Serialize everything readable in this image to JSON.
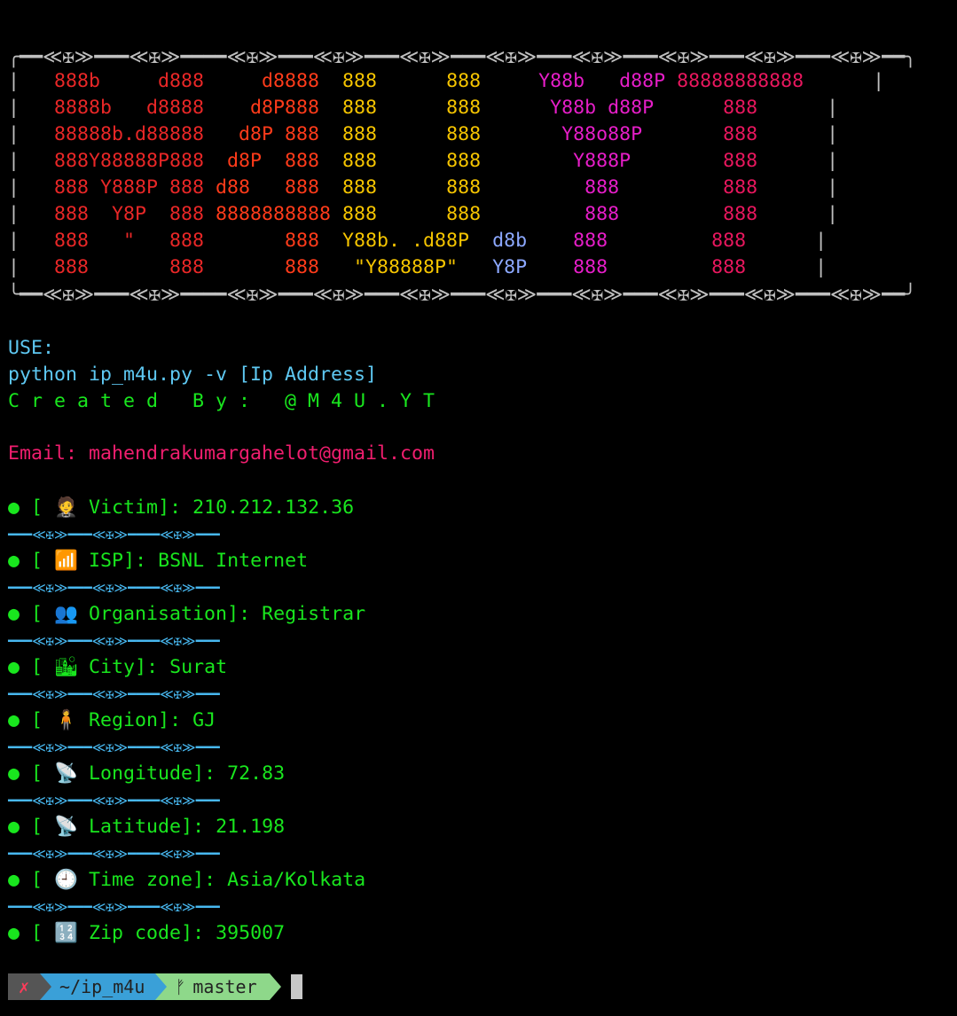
{
  "banner": {
    "top_border": "╭━━≪✠≫━━━≪✠≫━━━━≪✠≫━━━≪✠≫━━━≪✠≫━━━≪✠≫━━━≪✠≫━━━≪✠≫━━━≪✠≫━━━≪✠≫━━╮",
    "bottom_border": "╰━━≪✠≫━━━≪✠≫━━━━≪✠≫━━━≪✠≫━━━≪✠≫━━━≪✠≫━━━≪✠≫━━━≪✠≫━━━≪✠≫━━━≪✠≫━━╯",
    "lines": [
      [
        "|   ",
        "888b     d888",
        "     d8888",
        "  888",
        "      888",
        "     Y88b   d88P",
        " 88888888888",
        "      |"
      ],
      [
        "|   ",
        "8888b   d8888",
        "    d8P888",
        "  888",
        "      888",
        "      Y88b d88P",
        "      888",
        "      |"
      ],
      [
        "|   ",
        "88888b.d88888",
        "   d8P 888",
        "  888",
        "      888",
        "       Y88o88P",
        "       888",
        "      |"
      ],
      [
        "|   ",
        "888Y88888P888",
        "  d8P  888",
        "  888",
        "      888",
        "        Y888P",
        "        888",
        "      |"
      ],
      [
        "|   ",
        "888 Y888P 888",
        " d88   888",
        "  888",
        "      888",
        "         888",
        "         888",
        "      |"
      ],
      [
        "|   ",
        "888  Y8P  888",
        " 8888888888",
        " 888",
        "      888",
        "         888",
        "         888",
        "      |"
      ],
      [
        "|   ",
        "888   \"   888",
        "       888",
        "  Y88b. .d88P",
        "  d8b",
        "    888",
        "         888",
        "      |"
      ],
      [
        "|   ",
        "888       888",
        "       888",
        "   \"Y88888P\"",
        "   Y8P",
        "    888",
        "         888",
        "      |"
      ]
    ]
  },
  "use_label": "USE:",
  "usage": "python ip_m4u.py -v [Ip Address]",
  "created_by": "C r e a t e d   B y :   @ M 4 U . Y T",
  "email": "Email: mahendrakumargahelot@gmail.com",
  "separator": "━━━≪✠≫━━━≪✠≫━━━━≪✠≫━━━",
  "info": [
    {
      "icon": "🤵",
      "label": "Victim",
      "value": "210.212.132.36"
    },
    {
      "icon": "📶",
      "label": "ISP",
      "value": "BSNL Internet"
    },
    {
      "icon": "👥",
      "label": "Organisation",
      "value": "Registrar"
    },
    {
      "icon": "🏙",
      "label": "City",
      "value": "Surat"
    },
    {
      "icon": "🧍",
      "label": "Region",
      "value": "GJ"
    },
    {
      "icon": "📡",
      "label": "Longitude",
      "value": "72.83"
    },
    {
      "icon": "📡",
      "label": "Latitude",
      "value": "21.198"
    },
    {
      "icon": "🕘",
      "label": "Time zone",
      "value": "Asia/Kolkata"
    },
    {
      "icon": "🔢",
      "label": "Zip code",
      "value": "395007"
    }
  ],
  "prompt": {
    "status": "✗",
    "dir": "~/ip_m4u",
    "branch_icon": "ᚠ",
    "branch": "master"
  }
}
